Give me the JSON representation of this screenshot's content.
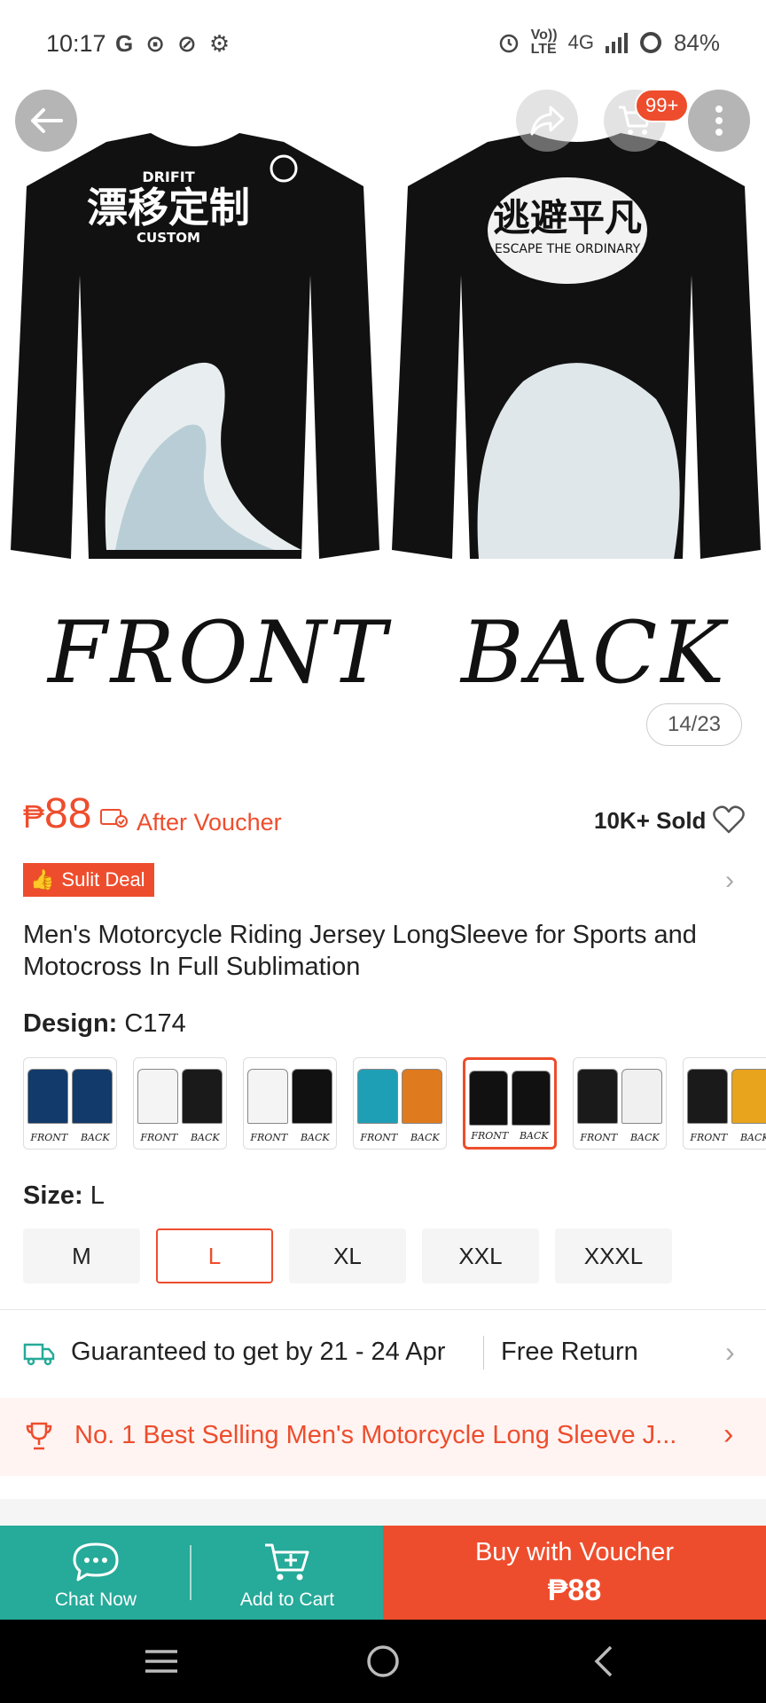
{
  "status_bar": {
    "time": "10:17",
    "left_icons": [
      "G",
      "⊙",
      "⊘",
      "⚙"
    ],
    "battery": "84%",
    "network": "4G",
    "volte_top": "Vo))",
    "volte_bottom": "LTE"
  },
  "gallery": {
    "front_label": "FRONT",
    "back_label": "BACK",
    "counter": "14/23",
    "cart_badge": "99+"
  },
  "price": {
    "currency": "₱",
    "amount": "88",
    "after_voucher": "After Voucher",
    "sold": "10K+ Sold"
  },
  "deal": {
    "label": "Sulit Deal"
  },
  "product": {
    "title": "Men's Motorcycle Riding Jersey LongSleeve for Sports and Motocross In Full Sublimation"
  },
  "design": {
    "label": "Design:",
    "value": "C174",
    "variant_front": "FRONT",
    "variant_back": "BACK",
    "variants": [
      {
        "colors": [
          "#123a6a",
          "#123a6a"
        ]
      },
      {
        "colors": [
          "#f4f4f4",
          "#1a1a1a"
        ]
      },
      {
        "colors": [
          "#f4f4f4",
          "#111111"
        ]
      },
      {
        "colors": [
          "#1f9fb5",
          "#e07a1e"
        ]
      },
      {
        "colors": [
          "#111111",
          "#111111"
        ]
      },
      {
        "colors": [
          "#1a1a1a",
          "#f0f0f0"
        ]
      },
      {
        "colors": [
          "#1a1a1a",
          "#e8a41c"
        ]
      }
    ],
    "selected_index": 4
  },
  "size": {
    "label": "Size:",
    "value": "L",
    "options": [
      "M",
      "L",
      "XL",
      "XXL",
      "XXXL"
    ],
    "selected": "L"
  },
  "shipping": {
    "text": "Guaranteed to get by 21 - 24 Apr",
    "free_return": "Free Return"
  },
  "bestseller": {
    "text": "No. 1 Best Selling Men's Motorcycle Long Sleeve J..."
  },
  "actions": {
    "chat": "Chat Now",
    "cart": "Add to Cart",
    "buy_line1": "Buy with Voucher",
    "buy_line2": "₱88"
  },
  "colors": {
    "accent": "#ee4d2d",
    "teal": "#26aa99"
  }
}
